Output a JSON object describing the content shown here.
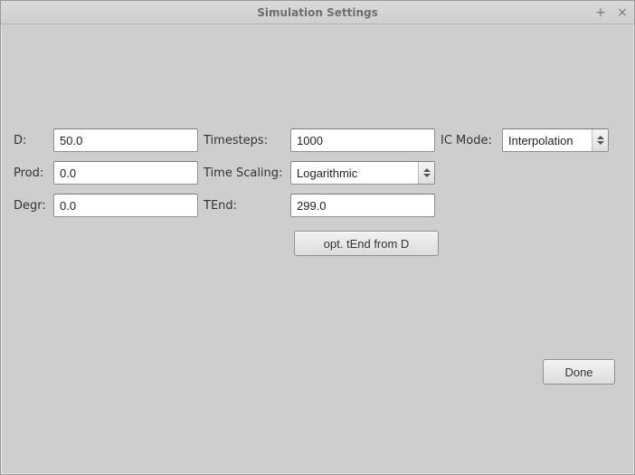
{
  "window": {
    "title": "Simulation Settings"
  },
  "labels": {
    "d": "D:",
    "prod": "Prod:",
    "degr": "Degr:",
    "timesteps": "Timesteps:",
    "time_scaling": "Time Scaling:",
    "tend": "TEnd:",
    "ic_mode": "IC Mode:"
  },
  "fields": {
    "d": "50.0",
    "prod": "0.0",
    "degr": "0.0",
    "timesteps": "1000",
    "time_scaling": "Logarithmic",
    "tend": "299.0",
    "ic_mode": "Interpolation"
  },
  "buttons": {
    "opt_tend": "opt. tEnd from D",
    "done": "Done"
  },
  "titlebar_icons": {
    "minimize": "+",
    "close": "×"
  }
}
